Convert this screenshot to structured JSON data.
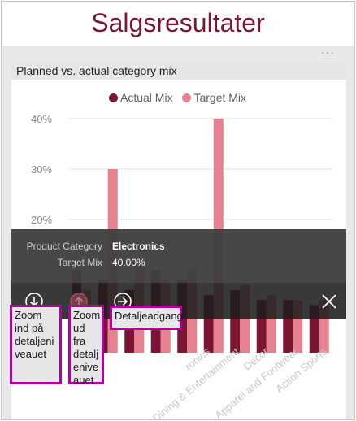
{
  "page": {
    "title": "Salgsresultater",
    "more_options": "···"
  },
  "visual": {
    "title": "Planned vs. actual category mix"
  },
  "chart_data": {
    "type": "bar",
    "title": "Planned vs. actual category mix",
    "series": [
      {
        "name": "Actual Mix",
        "color": "#7a1533",
        "values": [
          10,
          8,
          6,
          10,
          8,
          5,
          6,
          4,
          4,
          3
        ]
      },
      {
        "name": "Target Mix",
        "color": "#e6818f",
        "values": [
          6,
          30,
          12,
          8,
          10,
          40,
          7,
          5,
          4,
          4
        ]
      }
    ],
    "visible_category_labels": [
      "ronics",
      "Dining & Entertainment",
      "Decor",
      "Apparel and Footwear",
      "Action Sports"
    ],
    "y_ticks": [
      "40%",
      "30%",
      "20%"
    ],
    "ylim": [
      0,
      45
    ],
    "grid": true,
    "legend_position": "top"
  },
  "tooltip": {
    "rows": [
      {
        "label": "Product Category",
        "value": "Electronics"
      },
      {
        "label": "Target Mix",
        "value": "40.00%"
      }
    ]
  },
  "toolbar": {
    "drill_down_icon": "arrow-circle-down-icon",
    "drill_up_icon": "arrow-circle-up-icon",
    "drill_through_icon": "arrow-circle-right-icon",
    "close_icon": "close-icon"
  },
  "callouts": {
    "drill_down": "Zoom ind på detaljeni veauet",
    "drill_up": "Zoom ud fra detalj enive auet",
    "drill_through": "Detaljeadgang"
  },
  "colors": {
    "title": "#7a1533",
    "actual": "#7a1533",
    "target": "#e6818f",
    "callout_border": "#b4009e"
  }
}
